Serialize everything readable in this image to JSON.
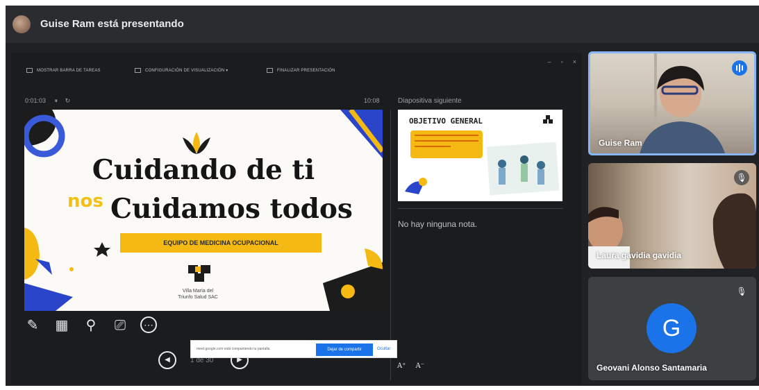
{
  "topbar": {
    "presenter_title": "Guise Ram está presentando"
  },
  "presenter_bar": {
    "show_taskbar": "MOSTRAR BARRA DE TAREAS",
    "display_settings": "CONFIGURACIÓN DE VISUALIZACIÓN ▾",
    "end_presentation": "FINALIZAR PRESENTACIÓN"
  },
  "timer": {
    "elapsed": "0:01:03",
    "pause_glyph": "⏸",
    "reset_glyph": "↻",
    "clock": "10:08"
  },
  "current_slide": {
    "line1": "Cuidando de ti",
    "nos": "nos",
    "line2": "Cuidamos todos",
    "banner": "EQUIPO DE MEDICINA OCUPACIONAL",
    "org": "Villa María del Triunfo Salud SAC"
  },
  "next_slide": {
    "label": "Diapositiva siguiente",
    "title": "OBJETIVO GENERAL"
  },
  "notes": {
    "text": "No hay ninguna nota."
  },
  "tools": [
    {
      "name": "pen-tool-icon",
      "glyph": "✎"
    },
    {
      "name": "grid-view-icon",
      "glyph": "▦"
    },
    {
      "name": "zoom-icon",
      "glyph": "⚲"
    },
    {
      "name": "screen-icon",
      "glyph": "⎚"
    },
    {
      "name": "more-options-icon",
      "glyph": "⋯"
    }
  ],
  "navigation": {
    "prev_glyph": "◀",
    "next_glyph": "▶",
    "page": "1 de 30"
  },
  "share_banner": {
    "text": "meet.google.com está compartiendo tu pantalla.",
    "stop_label": "Dejar de compartir",
    "hide_label": "Ocultar"
  },
  "font_controls": {
    "increase": "A⁺",
    "decrease": "A⁻"
  },
  "participants": [
    {
      "name": "Guise Ram",
      "status": "speaking"
    },
    {
      "name": "Laura gavidia gavidia",
      "status": "muted"
    },
    {
      "name": "Geovani Alonso Santamaria",
      "status": "muted",
      "initial": "G"
    }
  ],
  "colors": {
    "accent": "#1a73e8",
    "slide_yellow": "#f5b913",
    "background": "#202124"
  }
}
